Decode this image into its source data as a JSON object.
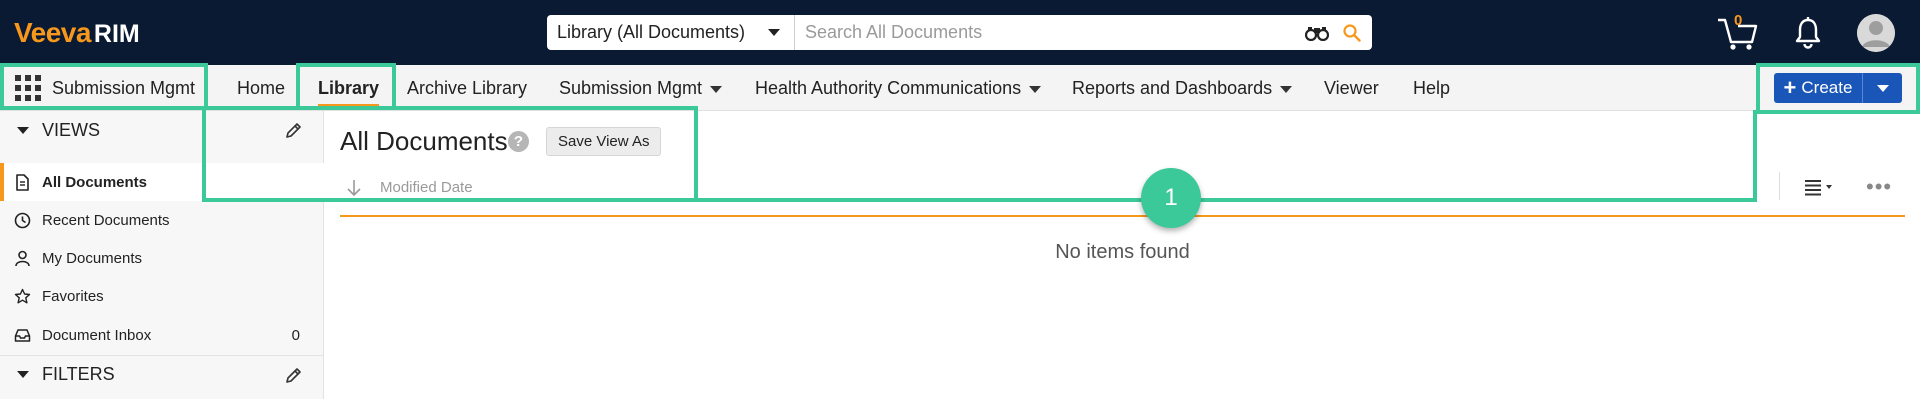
{
  "brand": {
    "logo_veeva": "Veeva",
    "logo_rim": "RIM",
    "accent": "#f7981d",
    "topbar_bg": "#0b1a33"
  },
  "search": {
    "scope": "Library (All Documents)",
    "placeholder": "Search All Documents"
  },
  "header_icons": {
    "cart_count": "0",
    "cart": "cart-icon",
    "notifications": "bell-icon",
    "user": "avatar-icon"
  },
  "nav": {
    "app_name": "Submission Mgmt",
    "items": [
      {
        "label": "Home"
      },
      {
        "label": "Library"
      },
      {
        "label": "Archive Library"
      },
      {
        "label": "Submission Mgmt"
      },
      {
        "label": "Health Authority Communications"
      },
      {
        "label": "Reports and Dashboards"
      },
      {
        "label": "Viewer"
      },
      {
        "label": "Help"
      }
    ],
    "create_label": "Create"
  },
  "sidebar": {
    "views_title": "VIEWS",
    "filters_title": "FILTERS",
    "items": [
      {
        "label": "All Documents"
      },
      {
        "label": "Recent Documents"
      },
      {
        "label": "My Documents"
      },
      {
        "label": "Favorites"
      },
      {
        "label": "Document Inbox",
        "count": "0"
      }
    ]
  },
  "main": {
    "title": "All Documents",
    "help": "?",
    "save_view_label": "Save View As",
    "sort_label": "Modified Date",
    "empty_text": "No items found",
    "more": "•••"
  },
  "annotation": {
    "callout_number": "1",
    "color": "#3cc99a"
  }
}
